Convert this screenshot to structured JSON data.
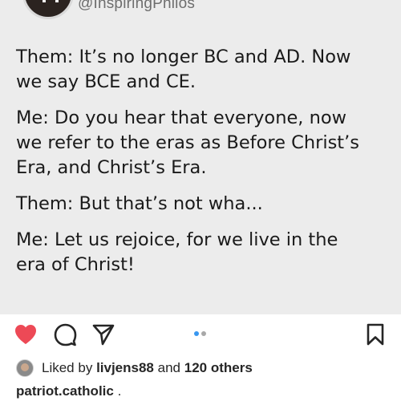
{
  "tweet": {
    "handle": "@InspiringPhilos",
    "paragraphs": [
      "Them: It’s no longer BC and AD. Now\nwe say BCE and CE.",
      "Me: Do you hear that everyone, now\nwe refer to the eras as Before Christ’s\nEra, and Christ’s Era.",
      "Them: But that’s not wha...",
      "Me: Let us rejoice, for we live in the\nera of Christ!"
    ]
  },
  "actions": {
    "like_icon": "heart-filled-icon",
    "comment_icon": "comment-icon",
    "share_icon": "send-icon",
    "save_icon": "bookmark-icon",
    "like_color": "#ed4956",
    "carousel_active_color": "#3897f0",
    "carousel_inactive_color": "#a8a8a8",
    "carousel_total": 2,
    "carousel_current": 1
  },
  "likes": {
    "prefix": "Liked by",
    "user": "livjens88",
    "joiner": "and",
    "others": "120 others"
  },
  "caption": {
    "username": "patriot.catholic",
    "text": "."
  }
}
